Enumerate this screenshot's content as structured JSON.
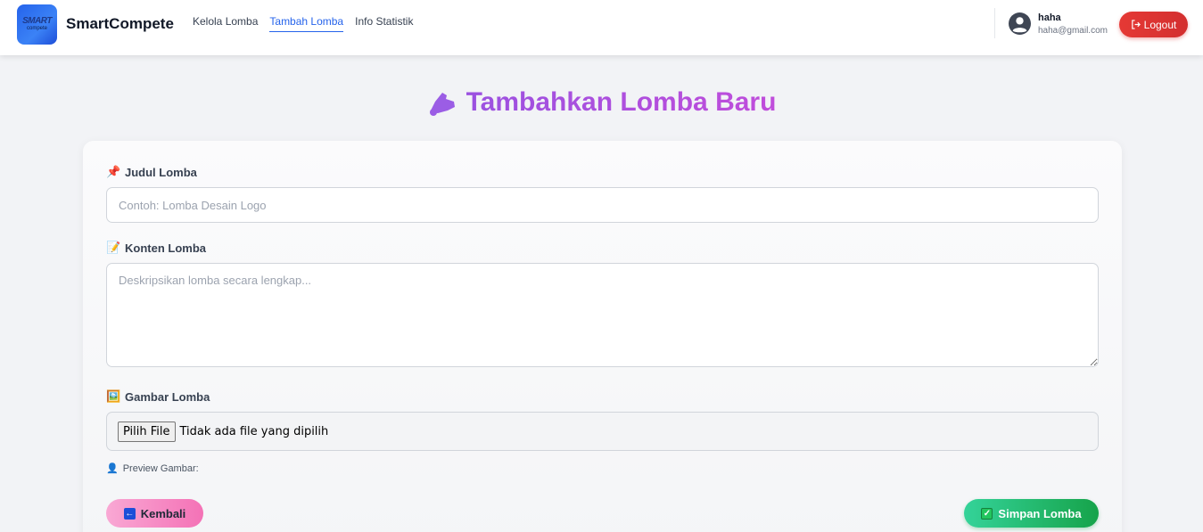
{
  "navbar": {
    "logo_text_top": "SMART",
    "logo_text_bottom": "compete",
    "brand": "SmartCompete",
    "links": [
      {
        "label": "Kelola Lomba"
      },
      {
        "label": "Tambah Lomba"
      },
      {
        "label": "Info Statistik"
      }
    ],
    "active_link": "Tambah Lomba",
    "user": {
      "name": "haha",
      "email": "haha@gmail.com"
    },
    "logout_label": "Logout",
    "logout_icon": "logout-icon"
  },
  "page": {
    "title_icon": "megaphone-icon",
    "title": "Tambahkan Lomba Baru"
  },
  "form": {
    "judul": {
      "emoji": "📌",
      "label": "Judul Lomba",
      "value": "",
      "placeholder": "Contoh: Lomba Desain Logo"
    },
    "konten": {
      "emoji": "📝",
      "label": "Konten Lomba",
      "value": "",
      "placeholder": "Deskripsikan lomba secara lengkap..."
    },
    "gambar": {
      "emoji": "🖼️",
      "label": "Gambar Lomba",
      "button_label": "Pilih File",
      "status": "Tidak ada file yang dipilih"
    },
    "preview": {
      "emoji": "👤",
      "label": "Preview Gambar:"
    },
    "back_button": {
      "icon": "back-arrow-icon",
      "label": "Kembali"
    },
    "save_button": {
      "icon": "check-icon",
      "label": "Simpan Lomba"
    }
  },
  "colors": {
    "accent_blue": "#2563eb",
    "title_purple": "#a855f7",
    "logout_red": "#dc2626",
    "save_green": "#16a34a",
    "back_pink": "#f472b6"
  }
}
